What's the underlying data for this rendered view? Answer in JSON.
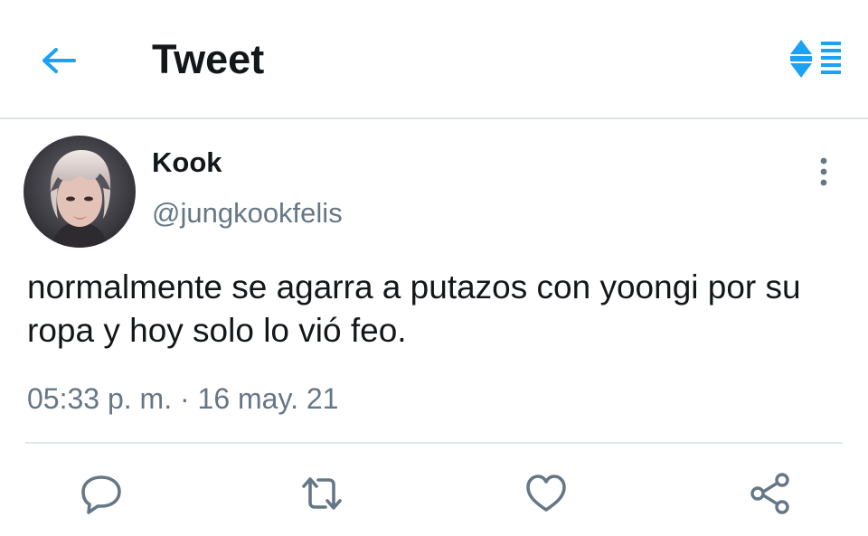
{
  "header": {
    "title": "Tweet",
    "back_icon": "arrow-left-icon",
    "sort_icon": "sort-list-icon",
    "accent_color": "#1da1f2"
  },
  "tweet": {
    "author": {
      "display_name": "Kook",
      "handle": "@jungkookfelis",
      "avatar_icon": "avatar-photo"
    },
    "text": "normalmente se agarra a putazos con yoongi por su ropa y hoy solo lo vió feo.",
    "timestamp": "05:33 p. m. · 16 may. 21",
    "more_icon": "more-vertical-icon"
  },
  "actions": [
    {
      "name": "reply",
      "icon": "reply-icon"
    },
    {
      "name": "retweet",
      "icon": "retweet-icon"
    },
    {
      "name": "like",
      "icon": "heart-icon"
    },
    {
      "name": "share",
      "icon": "share-icon"
    }
  ],
  "colors": {
    "text_primary": "#14171a",
    "text_secondary": "#657786",
    "divider": "#e1e8ed",
    "icon_gray": "#657786"
  }
}
